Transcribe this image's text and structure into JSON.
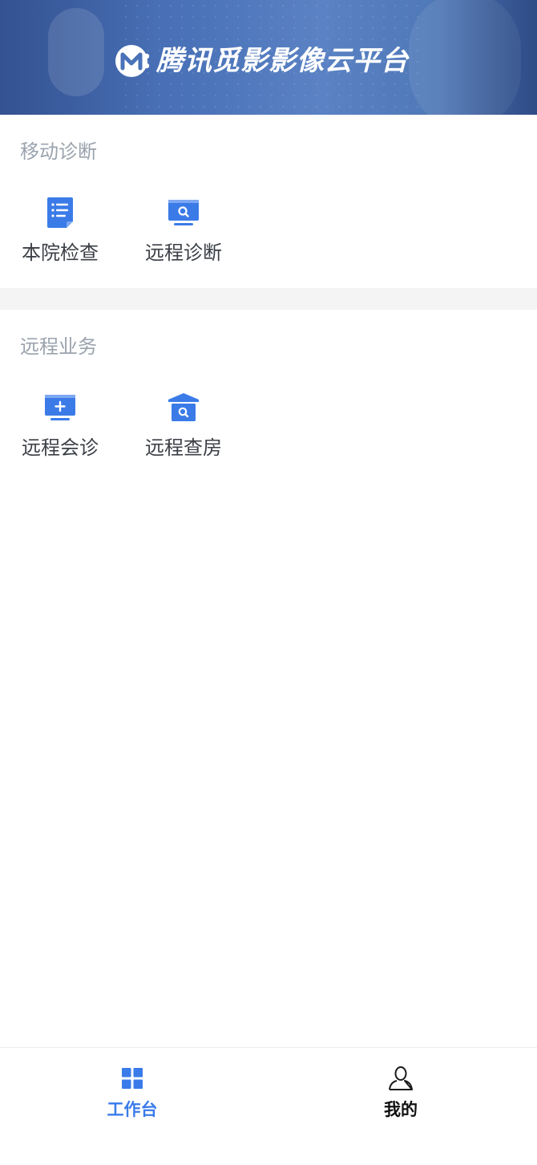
{
  "header": {
    "title": "腾讯觅影影像云平台",
    "logo_icon": "mi-ying-logo-icon"
  },
  "sections": [
    {
      "title": "移动诊断",
      "items": [
        {
          "label": "本院检查",
          "icon": "document-list-icon"
        },
        {
          "label": "远程诊断",
          "icon": "monitor-search-icon"
        }
      ]
    },
    {
      "title": "远程业务",
      "items": [
        {
          "label": "远程会诊",
          "icon": "monitor-plus-icon"
        },
        {
          "label": "远程查房",
          "icon": "house-search-icon"
        }
      ]
    }
  ],
  "tabbar": {
    "tabs": [
      {
        "label": "工作台",
        "icon": "grid-icon",
        "active": true
      },
      {
        "label": "我的",
        "icon": "user-icon",
        "active": false
      }
    ]
  },
  "colors": {
    "accent": "#3a7bea",
    "icon_blue": "#3b7be8",
    "section_title": "#9aa3ad",
    "tile_label": "#3b3f46",
    "banner": "#4a72b8",
    "gap": "#f4f4f5"
  }
}
